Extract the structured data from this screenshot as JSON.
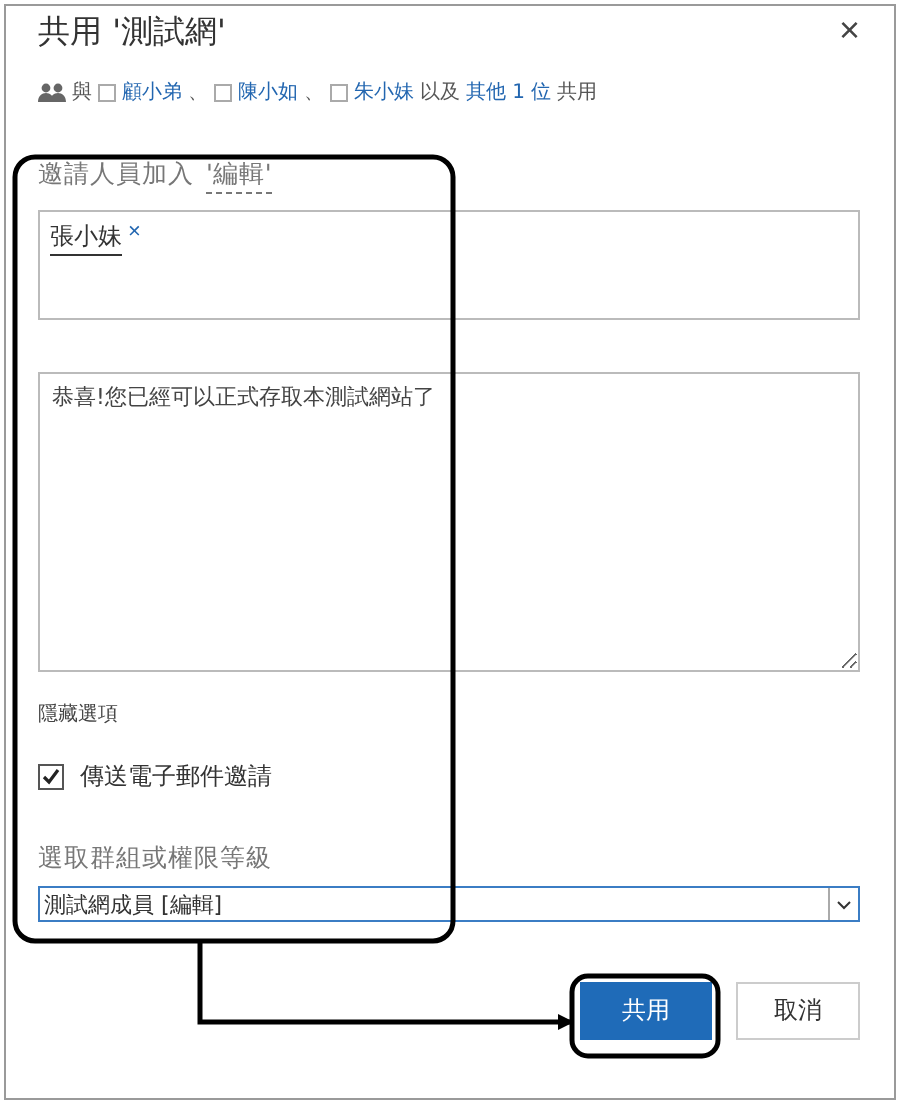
{
  "dialog": {
    "title": "共用 '測試網'",
    "close": "×"
  },
  "shared_with": {
    "prefix": "與",
    "people": [
      {
        "name": "顧小弟"
      },
      {
        "name": "陳小如"
      },
      {
        "name": "朱小妹"
      }
    ],
    "separator": "、",
    "conjunction": "以及",
    "others_link": "其他 1 位",
    "suffix": "共用"
  },
  "invite": {
    "label_prefix": "邀請人員加入",
    "permission": "'編輯'",
    "people": [
      {
        "name": "張小妹",
        "remove": "×"
      }
    ]
  },
  "message": {
    "value": "恭喜!您已經可以正式存取本測試網站了"
  },
  "options": {
    "toggle": "隱藏選項",
    "send_email": {
      "label": "傳送電子郵件邀請",
      "checked": true
    }
  },
  "group": {
    "label": "選取群組或權限等級",
    "value": "測試網成員 [編輯]"
  },
  "buttons": [
    {
      "label": "共用",
      "kind": "primary"
    },
    {
      "label": "取消",
      "kind": "secondary"
    }
  ]
}
